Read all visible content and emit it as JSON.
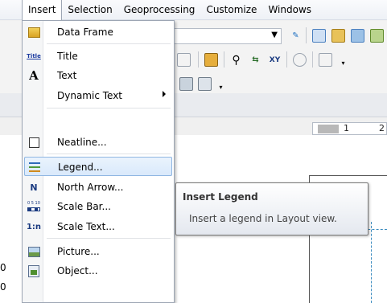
{
  "menubar": {
    "items": [
      {
        "label": "Insert",
        "open": true
      },
      {
        "label": "Selection"
      },
      {
        "label": "Geoprocessing"
      },
      {
        "label": "Customize"
      },
      {
        "label": "Windows"
      }
    ]
  },
  "insert_menu": {
    "items": [
      {
        "label": "Data Frame",
        "icon": "data-frame-icon"
      },
      {
        "label": "Title",
        "icon": "title-icon",
        "icon_text": "Title"
      },
      {
        "label": "Text",
        "icon": "text-icon",
        "icon_text": "A"
      },
      {
        "label": "Dynamic Text",
        "has_submenu": true
      },
      {
        "label": "Neatline...",
        "icon": "neatline-icon"
      },
      {
        "label": "Legend...",
        "icon": "legend-icon",
        "highlighted": true
      },
      {
        "label": "North Arrow...",
        "icon": "north-arrow-icon",
        "icon_text": "N"
      },
      {
        "label": "Scale Bar...",
        "icon": "scale-bar-icon",
        "icon_text": "0 5 10"
      },
      {
        "label": "Scale Text...",
        "icon": "scale-text-icon",
        "icon_text": "1:n"
      },
      {
        "label": "Picture...",
        "icon": "picture-icon"
      },
      {
        "label": "Object...",
        "icon": "object-icon"
      }
    ]
  },
  "tooltip": {
    "title": "Insert Legend",
    "body": "Insert a legend in Layout view."
  },
  "background": {
    "ruler_marks": [
      "1",
      "2"
    ],
    "toolbar_icon_text": "XY",
    "left_edge_digits": [
      "0",
      "0"
    ]
  },
  "colors": {
    "highlight_border": "#8fb6e2",
    "highlight_fill": "#d9e9fb",
    "menu_border": "#9da6b4",
    "guide_line": "#3a8bbf"
  }
}
